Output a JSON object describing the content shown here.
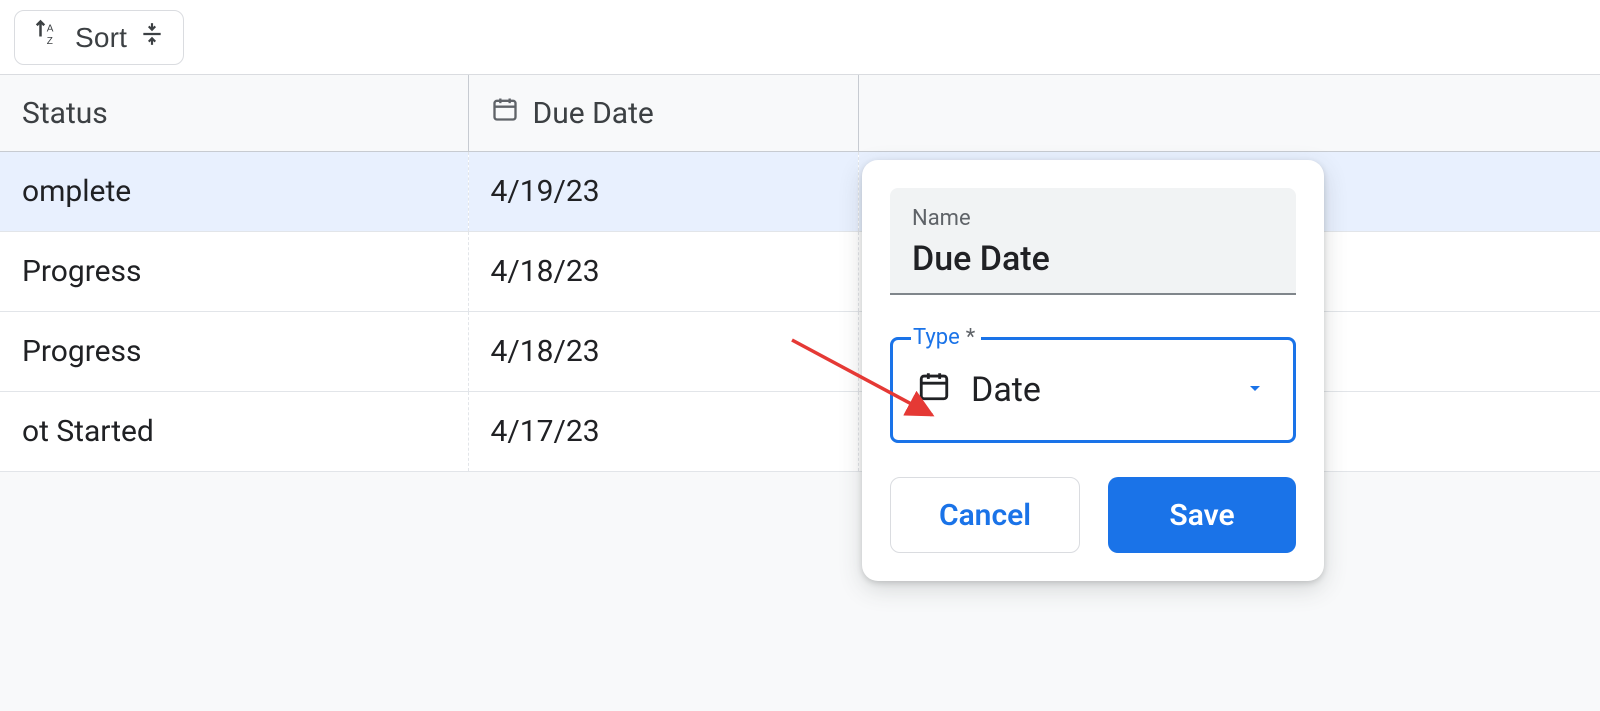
{
  "toolbar": {
    "sort_label": "Sort"
  },
  "columns": {
    "status": "Status",
    "due_date": "Due Date"
  },
  "rows": [
    {
      "status": "omplete",
      "due": "4/19/23",
      "selected": true
    },
    {
      "status": "Progress",
      "due": "4/18/23",
      "selected": false
    },
    {
      "status": "Progress",
      "due": "4/18/23",
      "selected": false
    },
    {
      "status": "ot Started",
      "due": "4/17/23",
      "selected": false
    }
  ],
  "popup": {
    "name_label": "Name",
    "name_value": "Due Date",
    "type_label": "Type",
    "type_required_mark": "*",
    "type_value": "Date",
    "cancel_label": "Cancel",
    "save_label": "Save"
  }
}
